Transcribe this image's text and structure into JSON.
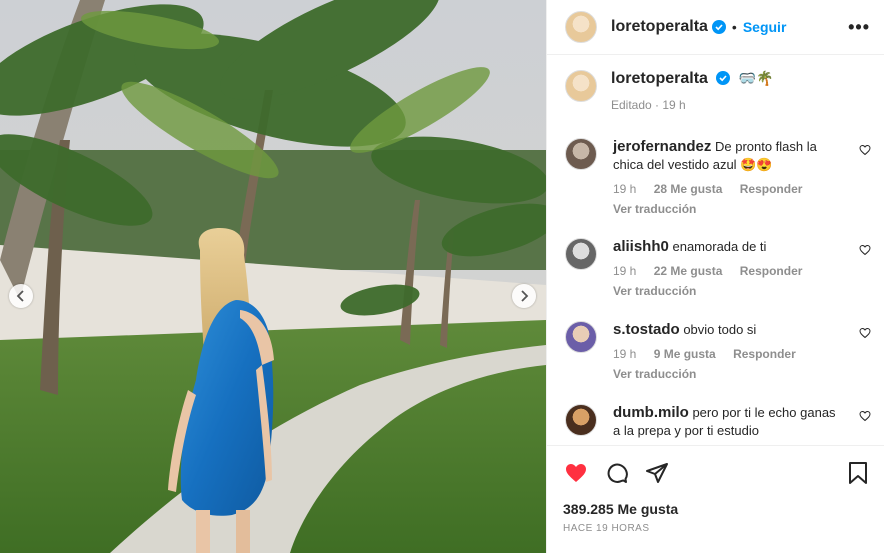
{
  "post": {
    "author": "loretoperalta",
    "follow_label": "Seguir",
    "more_label": "•••",
    "caption_emoji": "🥽🌴",
    "caption_meta": "Editado · 19 h",
    "likes": "389.285 Me gusta",
    "time_ago": "HACE 19 HORAS"
  },
  "comments": [
    {
      "user": "jerofernandez",
      "text": "De pronto flash la chica del vestido azul 🤩😍",
      "time": "19 h",
      "likes": "28 Me gusta",
      "reply": "Responder",
      "translate": "Ver traducción"
    },
    {
      "user": "aliishh0",
      "text": "enamorada de ti",
      "time": "19 h",
      "likes": "22 Me gusta",
      "reply": "Responder",
      "translate": "Ver traducción"
    },
    {
      "user": "s.tostado",
      "text": "obvio todo si",
      "time": "19 h",
      "likes": "9 Me gusta",
      "reply": "Responder",
      "translate": "Ver traducción"
    },
    {
      "user": "dumb.milo",
      "text": "pero por ti le echo ganas a la prepa y por ti estudio",
      "time": "",
      "likes": "",
      "reply": "",
      "translate": ""
    }
  ],
  "colors": {
    "like_red": "#ff3040",
    "link_blue": "#0095f6",
    "muted": "#8e8e8e"
  },
  "icons": [
    "chevron-left-icon",
    "chevron-right-icon",
    "verified-icon",
    "more-icon",
    "heart-icon",
    "comment-icon",
    "share-icon",
    "bookmark-icon"
  ]
}
